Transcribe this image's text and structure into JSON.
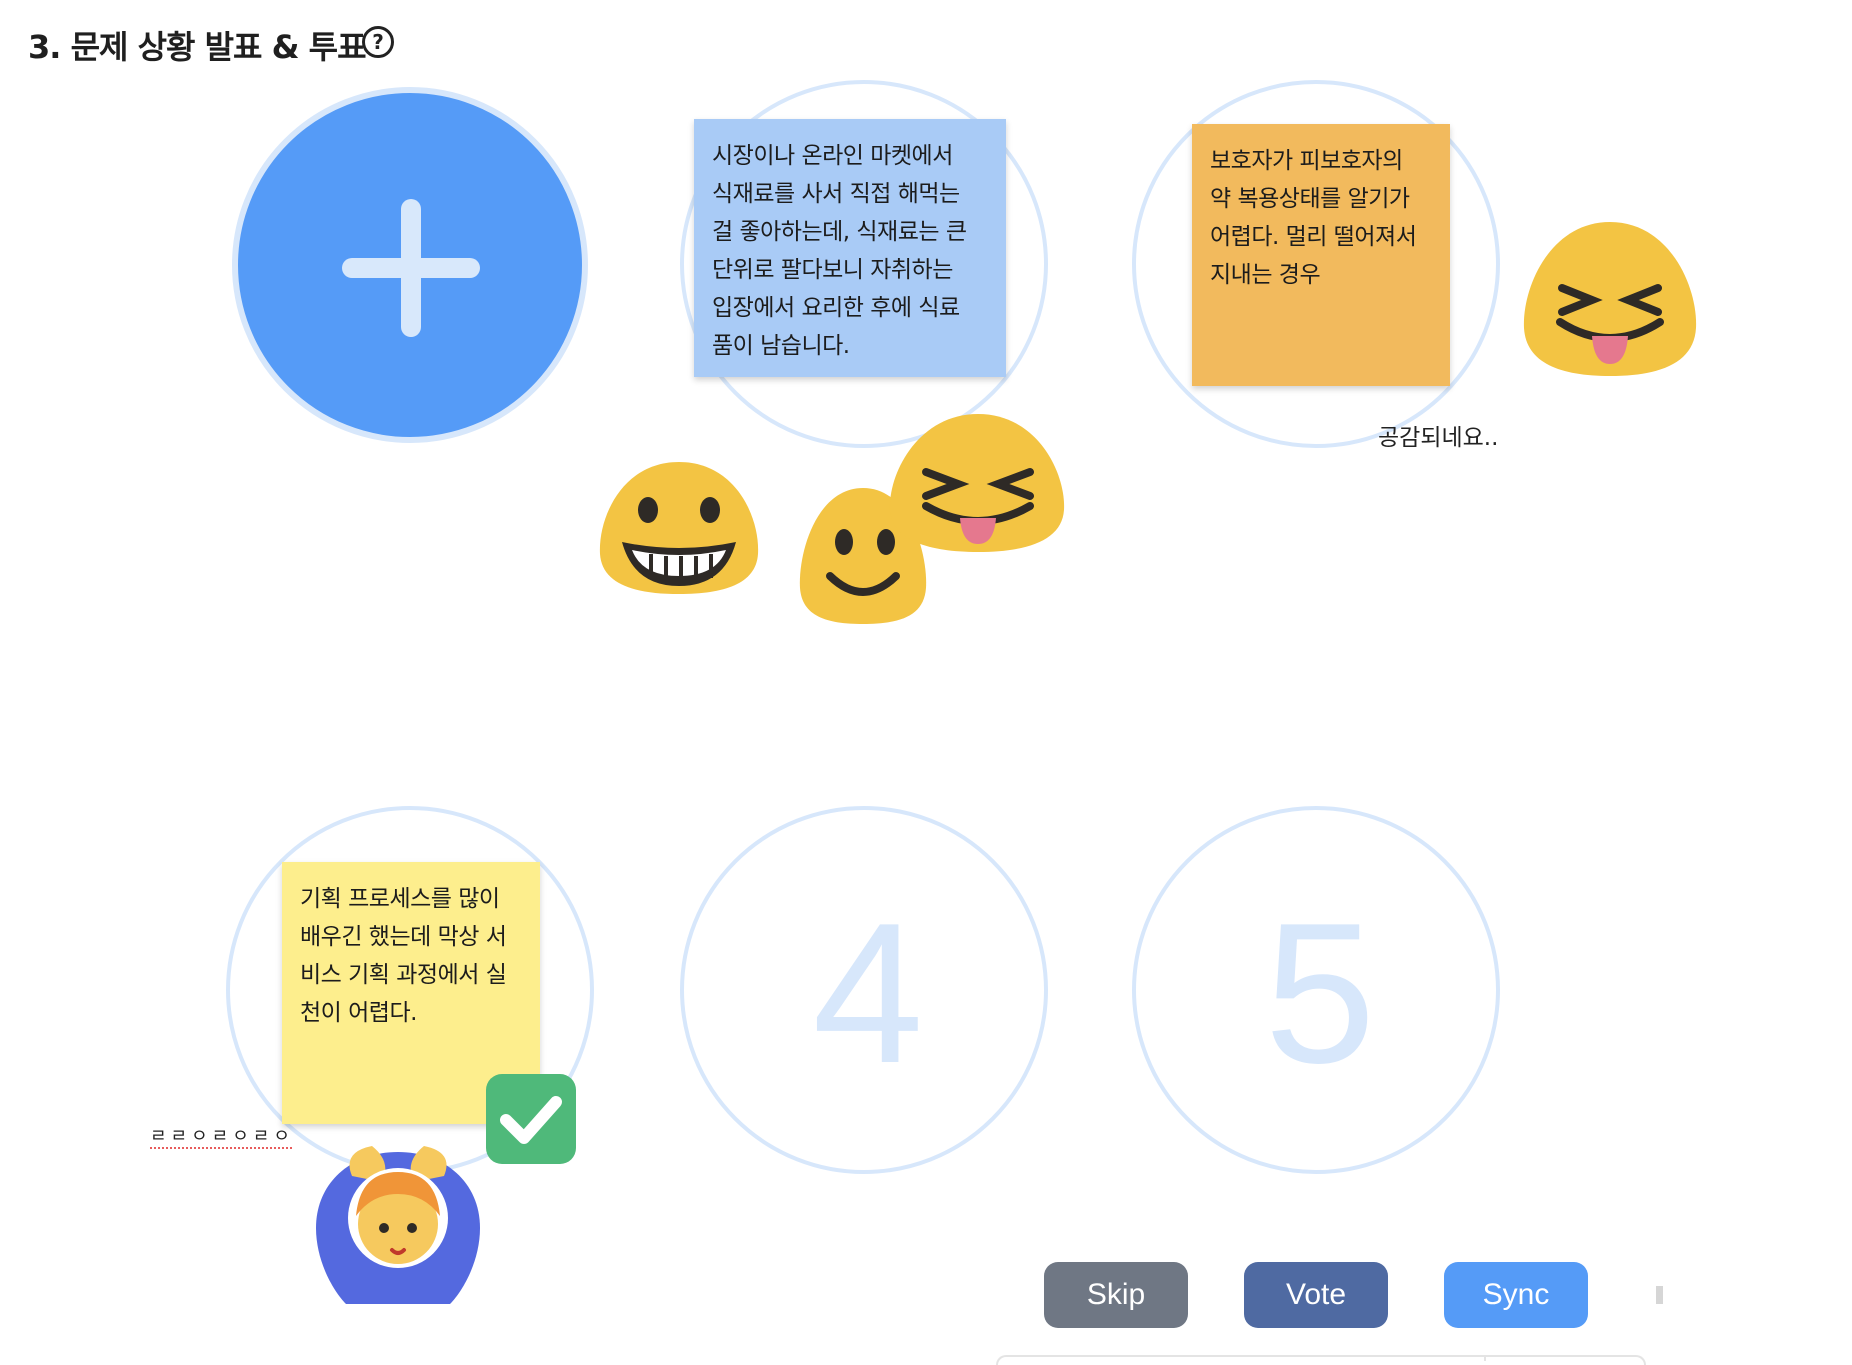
{
  "header": {
    "title": "3. 문제 상황 발표 & 투표",
    "help_glyph": "?"
  },
  "colors": {
    "accent_blue": "#559bf7",
    "slot_ring": "#d7e7fb",
    "sticky_blue": "#a9cbf6",
    "sticky_orange": "#f2ba5d",
    "sticky_yellow": "#fdee8d",
    "skip": "#6f7784",
    "vote": "#4f6aa2",
    "sync": "#559bf7",
    "check_green": "#4fb97a"
  },
  "board": {
    "slots": [
      {
        "number": "",
        "content": "add-button"
      },
      {
        "number": "",
        "content": "sticky-blue"
      },
      {
        "number": "",
        "content": "sticky-orange"
      },
      {
        "number": "",
        "content": "sticky-yellow"
      },
      {
        "number": "4"
      },
      {
        "number": "5"
      }
    ],
    "stickies": [
      {
        "color": "blue",
        "lines": [
          "시장이나 온라인 마켓에서",
          "식재료를 사서 직접 해먹는",
          "걸 좋아하는데, 식재료는 큰",
          "단위로 팔다보니 자취하는",
          "입장에서 요리한 후에 식료",
          "품이 남습니다."
        ]
      },
      {
        "color": "orange",
        "lines": [
          "보호자가 피보호자의",
          "약 복용상태를 알기가",
          "어렵다. 멀리 떨어져서",
          "지내는 경우"
        ]
      },
      {
        "color": "yellow",
        "lines": [
          "기획 프로세스를 많이",
          "배우긴 했는데 막상 서",
          "비스 기획 과정에서 실",
          "천이 어렵다."
        ]
      }
    ],
    "comments": [
      {
        "text": "공감되네요.."
      },
      {
        "text": "ㄹㄹㅇㄹㅇㄹㅇ"
      }
    ],
    "reactions": [
      "grinning-emoji",
      "smiling-emoji",
      "squinting-tongue-emoji",
      "squinting-tongue-emoji",
      "ok-gesture-person",
      "check-mark"
    ]
  },
  "actions": {
    "skip_label": "Skip",
    "vote_label": "Vote",
    "sync_label": "Sync"
  }
}
